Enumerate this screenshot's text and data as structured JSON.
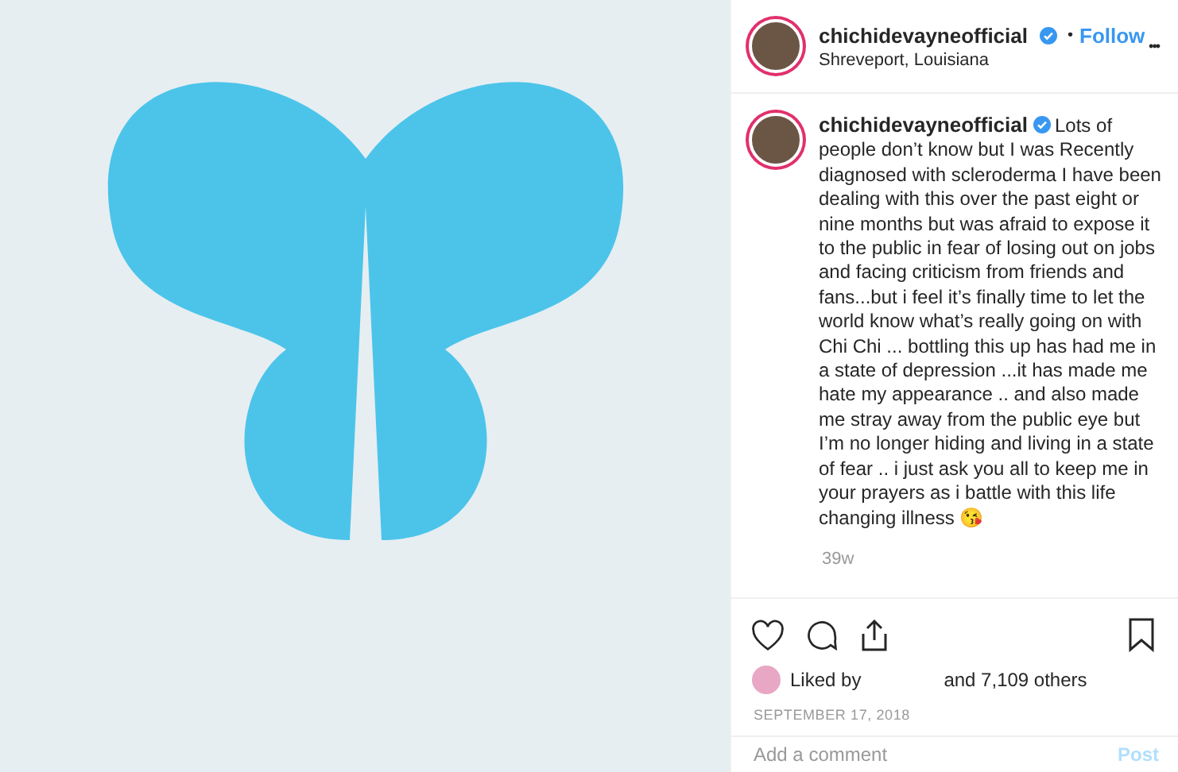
{
  "post_image": {
    "kind": "graphic"
  },
  "header": {
    "username": "chichidevayneofficial",
    "verified": true,
    "separator": "•",
    "follow": "Follow",
    "location": "Shreveport, Louisiana",
    "menu": "•••"
  },
  "caption": {
    "username": "chichidevayneofficial",
    "verified": true,
    "text": "Lots of people don’t know but I was Recently diagnosed with scleroderma I have been dealing with this over the past eight or nine months but was afraid to expose it to the public in fear of losing out on jobs and facing criticism from friends and fans...but i feel it’s finally time to let the world know what’s really going on with Chi Chi ... bottling this up has had me in a state of depression ...it has made me hate my appearance .. and also made me stray away from the public eye but I’m no longer hiding and living in a state of fear .. i just ask you all to keep me in your prayers as i battle with this life changing illness 😘",
    "age": "39w"
  },
  "likes": {
    "prefix": "Liked by",
    "suffix": "and 7,109 others"
  },
  "date": "SEPTEMBER 17, 2018",
  "comment": {
    "placeholder": "Add a comment",
    "post": "Post"
  }
}
